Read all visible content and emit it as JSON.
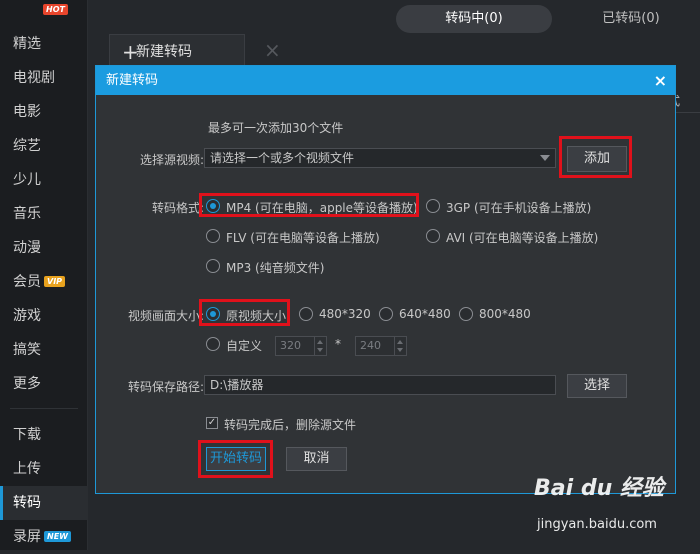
{
  "sidebar": {
    "items": [
      {
        "label": "",
        "badge": "HOT"
      },
      {
        "label": "精选"
      },
      {
        "label": "电视剧"
      },
      {
        "label": "电影"
      },
      {
        "label": "综艺"
      },
      {
        "label": "少儿"
      },
      {
        "label": "音乐"
      },
      {
        "label": "动漫"
      },
      {
        "label": "会员",
        "badge": "VIP"
      },
      {
        "label": "游戏"
      },
      {
        "label": "搞笑"
      },
      {
        "label": "更多"
      },
      {
        "label": "下载"
      },
      {
        "label": "上传"
      },
      {
        "label": "转码",
        "active": true
      },
      {
        "label": "录屏",
        "badge": "NEW"
      }
    ]
  },
  "top_tabs": {
    "converting": "转码中(0)",
    "converted": "已转码(0)"
  },
  "toolbar": {
    "new_convert": "新建转码",
    "plus": "+",
    "close": "×",
    "partial_column": "式"
  },
  "dialog": {
    "title": "新建转码",
    "close": "×",
    "hint": "最多可一次添加30个文件",
    "source_label": "选择源视频:",
    "source_placeholder": "请选择一个或多个视频文件",
    "add_button": "添加",
    "format_label": "转码格式:",
    "formats": [
      {
        "label": "MP4 (可在电脑，apple等设备播放)",
        "checked": true
      },
      {
        "label": "3GP (可在手机设备上播放)",
        "checked": false
      },
      {
        "label": "FLV (可在电脑等设备上播放)",
        "checked": false
      },
      {
        "label": "AVI (可在电脑等设备上播放)",
        "checked": false
      },
      {
        "label": "MP3 (纯音频文件)",
        "checked": false
      }
    ],
    "size_label": "视频画面大小:",
    "sizes": [
      {
        "label": "原视频大小",
        "checked": true
      },
      {
        "label": "480*320",
        "checked": false
      },
      {
        "label": "640*480",
        "checked": false
      },
      {
        "label": "800*480",
        "checked": false
      }
    ],
    "custom_label": "自定义",
    "custom_width": "320",
    "custom_height": "240",
    "custom_sep": "*",
    "path_label": "转码保存路径:",
    "path_value": "D:\\播放器",
    "choose_button": "选择",
    "delete_source_label": "转码完成后，删除源文件",
    "delete_source_checked": true,
    "checkmark": "✓",
    "start_button": "开始转码",
    "cancel_button": "取消"
  },
  "watermark": {
    "logo": "Bai du 经验",
    "url": "jingyan.baidu.com"
  },
  "colors": {
    "accent": "#1e98d7",
    "highlight": "#e0111b",
    "hot": "#e8452c",
    "vip": "#e8a21e"
  }
}
